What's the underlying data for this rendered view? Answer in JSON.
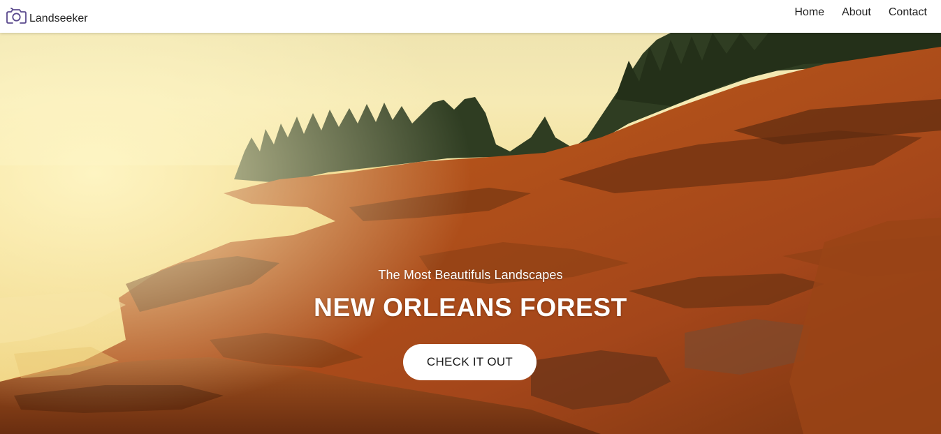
{
  "brand": {
    "name": "Landseeker",
    "logo_icon": "camera-icon",
    "logo_color": "#5b4a8e"
  },
  "nav": {
    "items": [
      {
        "label": "Home"
      },
      {
        "label": "About"
      },
      {
        "label": "Contact"
      }
    ]
  },
  "hero": {
    "subtitle": "The Most Beautifuls Landscapes",
    "title": "NEW ORLEANS FOREST",
    "cta_label": "CHECK IT OUT",
    "image_description_colors": {
      "sky": "#f3e7a6",
      "water": "#f0d98a",
      "rock": "#b04a14",
      "trees": "#2c3b21"
    }
  }
}
